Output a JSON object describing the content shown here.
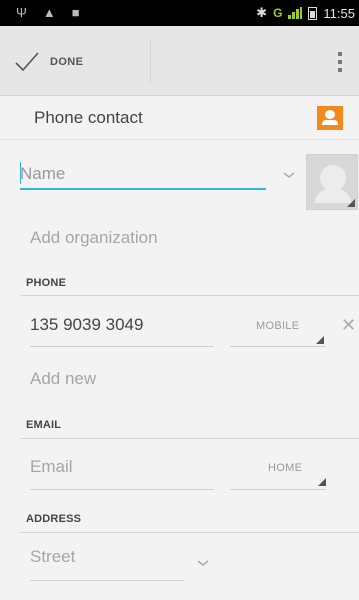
{
  "status_bar": {
    "left_icons": [
      "usb-icon",
      "warning-icon",
      "screenshot-icon"
    ],
    "network": "G",
    "time": "11:55"
  },
  "action_bar": {
    "done_label": "DONE",
    "overflow_icon": "overflow-menu-icon"
  },
  "account": {
    "label": "Phone contact",
    "icon": "contact-card-icon",
    "icon_color": "#f28a1e"
  },
  "name": {
    "placeholder": "Name",
    "accent_color": "#33b5e5"
  },
  "organization": {
    "label": "Add organization"
  },
  "phone": {
    "header": "PHONE",
    "value": "135 9039 3049",
    "type": "MOBILE",
    "add_new": "Add new"
  },
  "email": {
    "header": "EMAIL",
    "placeholder": "Email",
    "type": "HOME"
  },
  "address": {
    "header": "ADDRESS",
    "placeholder": "Street"
  }
}
